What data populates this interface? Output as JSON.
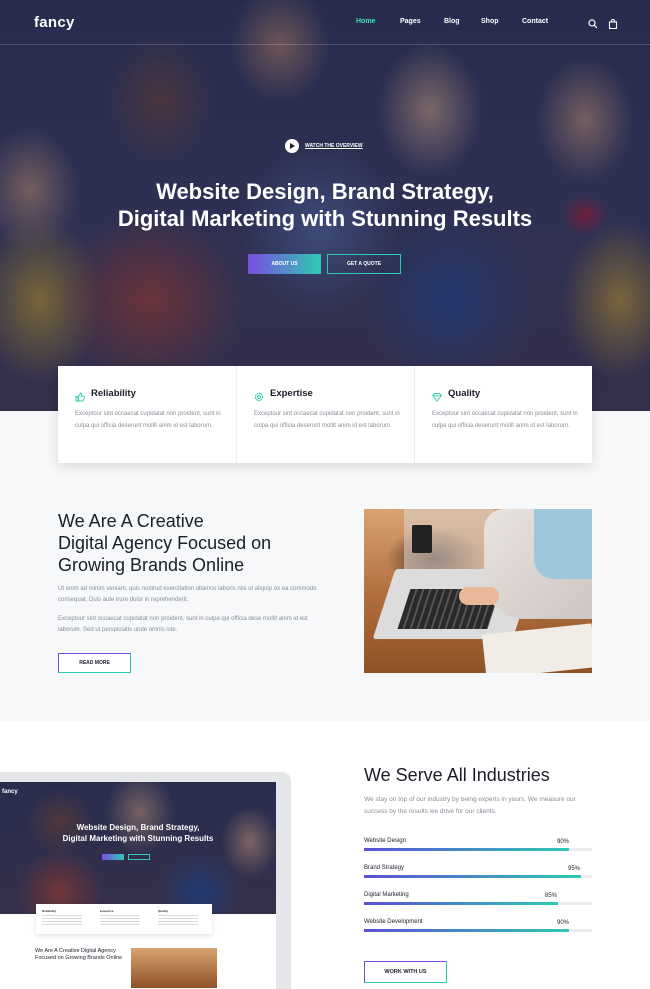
{
  "nav": {
    "logo": "fancy",
    "items": [
      {
        "label": "Home",
        "active": true
      },
      {
        "label": "Pages",
        "active": false
      },
      {
        "label": "Blog",
        "active": false
      },
      {
        "label": "Shop",
        "active": false
      },
      {
        "label": "Contact",
        "active": false
      }
    ],
    "icons": [
      "search-icon",
      "bag-icon"
    ]
  },
  "hero": {
    "watch_label": "WATCH THE OVERVIEW",
    "title_line1": "Website Design, Brand Strategy,",
    "title_line2": "Digital Marketing with Stunning Results",
    "btn_primary": "ABOUT US",
    "btn_secondary": "GET A QUOTE"
  },
  "features": [
    {
      "title": "Reliability",
      "icon": "thumbs-up-icon",
      "text": "Exceptour sint occaecat cupidatat non proident, sunt in culpa qui officia deserunt mollit anim id est laborum."
    },
    {
      "title": "Expertise",
      "icon": "gear-icon",
      "text": "Exceptour sint occaecat cupidatat non proident, sunt in culpa qui officia deserunt mollit anim id est laborum."
    },
    {
      "title": "Quality",
      "icon": "diamond-icon",
      "text": "Exceptour sint occaecat cupidatat non proident, sunt in culpa qui officia deserunt mollit anim id est laborum."
    }
  ],
  "about": {
    "title_line1": "We Are A Creative",
    "title_line2": "Digital Agency Focused on",
    "title_line3": "Growing Brands Online",
    "text1": "Ut enim ad minim veniam, quis nostrud exercitation ullamco laboris nisi ut aliquip ex ea commodo consequat. Duis aute irure dolor in reprehenderit.",
    "text2": "Exceptour sint occaecat cupidatat non proident, sunt in culpa qui officia dese mollit anim id est laborum. Sed ut perspiciatis unde omnis iste.",
    "btn": "READ MORE"
  },
  "mockup": {
    "logo": "fancy",
    "title_line1": "Website Design, Brand Strategy,",
    "title_line2": "Digital Marketing with Stunning Results",
    "card_labels": [
      "Reliability",
      "Expertise",
      "Quality"
    ],
    "about_title": "We Are A Creative Digital Agency Focused on Growing Brands Online"
  },
  "industries": {
    "title": "We Serve All Industries",
    "text": "We stay on top of our industry by being experts in yours. We measure our success by the results we drive for our clients.",
    "skills": [
      {
        "name": "Website Design",
        "percent_label": "90%",
        "value": 90
      },
      {
        "name": "Brand Strategy",
        "percent_label": "95%",
        "value": 95
      },
      {
        "name": "Digital Marketing",
        "percent_label": "85%",
        "value": 85
      },
      {
        "name": "Website Development",
        "percent_label": "90%",
        "value": 90
      }
    ],
    "btn": "WORK WITH US"
  },
  "colors": {
    "accent_purple": "#7a4de0",
    "accent_teal": "#2ec9b3",
    "active_nav": "#3fe0b8"
  }
}
